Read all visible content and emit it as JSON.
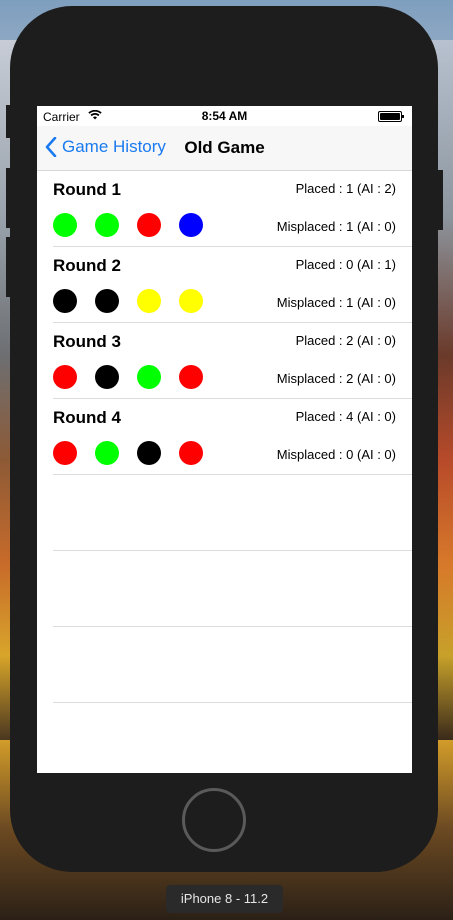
{
  "device_label": "iPhone 8 - 11.2",
  "status_bar": {
    "carrier": "Carrier",
    "time": "8:54 AM"
  },
  "nav": {
    "back_label": "Game History",
    "title": "Old Game"
  },
  "colors": {
    "accent": "#1a7bf0"
  },
  "rounds": [
    {
      "label": "Round 1",
      "placed": "Placed : 1 (AI : 2)",
      "misplaced": "Misplaced : 1 (AI : 0)",
      "pegs": [
        "#00ff00",
        "#00ff00",
        "#ff0000",
        "#0000ff"
      ]
    },
    {
      "label": "Round 2",
      "placed": "Placed : 0 (AI : 1)",
      "misplaced": "Misplaced : 1 (AI : 0)",
      "pegs": [
        "#000000",
        "#000000",
        "#ffff00",
        "#ffff00"
      ]
    },
    {
      "label": "Round 3",
      "placed": "Placed : 2 (AI : 0)",
      "misplaced": "Misplaced : 2 (AI : 0)",
      "pegs": [
        "#ff0000",
        "#000000",
        "#00ff00",
        "#ff0000"
      ]
    },
    {
      "label": "Round 4",
      "placed": "Placed : 4 (AI : 0)",
      "misplaced": "Misplaced : 0 (AI : 0)",
      "pegs": [
        "#ff0000",
        "#00ff00",
        "#000000",
        "#ff0000"
      ]
    }
  ]
}
